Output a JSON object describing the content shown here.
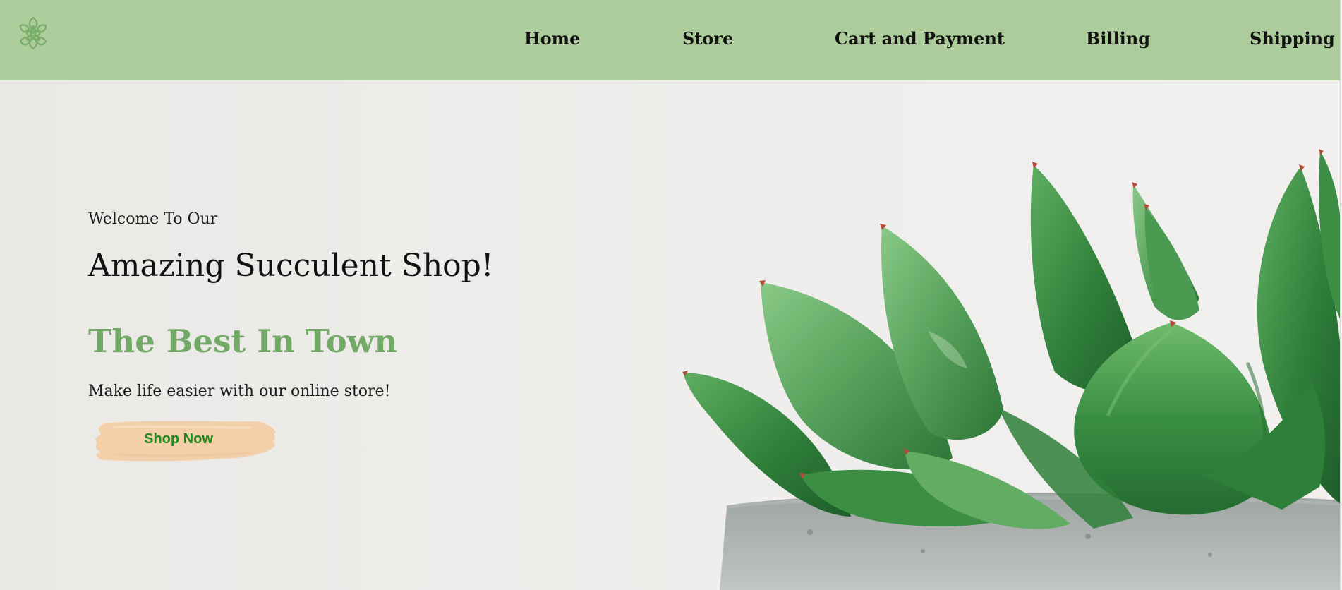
{
  "header": {
    "logo_icon": "succulent-rosette-logo-icon",
    "nav": [
      {
        "label": "Home"
      },
      {
        "label": "Store"
      },
      {
        "label": "Cart and Payment"
      },
      {
        "label": "Billing"
      },
      {
        "label": "Shipping"
      }
    ]
  },
  "hero": {
    "welcome": "Welcome To Our",
    "headline": "Amazing Succulent Shop!",
    "subheadline": "The Best In Town",
    "tagline": "Make life easier with our online store!",
    "cta_label": "Shop Now",
    "image_subject": "potted-succulent"
  },
  "colors": {
    "nav_background": "#aecd9d",
    "page_background": "#ebe9e6",
    "accent_green": "#73a967",
    "cta_background": "#f3d0a9",
    "cta_text": "#1c8a1c"
  }
}
